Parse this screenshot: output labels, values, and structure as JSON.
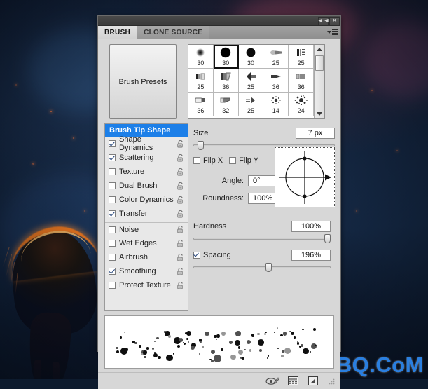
{
  "background": {
    "watermark": "UiBQ.CoM"
  },
  "panel": {
    "titlebar": {
      "collapse_label": "◄◄",
      "close_label": "✕"
    },
    "tabs": [
      {
        "label": "BRUSH",
        "active": true
      },
      {
        "label": "CLONE SOURCE",
        "active": false
      }
    ],
    "menu_icon": "panel-menu-icon",
    "brush_presets_button": "Brush Presets",
    "brush_grid": {
      "cells": [
        {
          "size": "30",
          "shape": "soft-round",
          "selected": false
        },
        {
          "size": "30",
          "shape": "hard-round",
          "selected": true
        },
        {
          "size": "30",
          "shape": "hard-round-2",
          "selected": false
        },
        {
          "size": "25",
          "shape": "flat-tip",
          "selected": false
        },
        {
          "size": "25",
          "shape": "bristle-block",
          "selected": false
        },
        {
          "size": "25",
          "shape": "flat-block",
          "selected": false
        },
        {
          "size": "36",
          "shape": "angled-block",
          "selected": false
        },
        {
          "size": "25",
          "shape": "fan-tip",
          "selected": false
        },
        {
          "size": "36",
          "shape": "round-point",
          "selected": false
        },
        {
          "size": "36",
          "shape": "square-tip",
          "selected": false
        },
        {
          "size": "36",
          "shape": "rounded-tip",
          "selected": false
        },
        {
          "size": "32",
          "shape": "chisel-tip",
          "selected": false
        },
        {
          "size": "25",
          "shape": "fan-soft",
          "selected": false
        },
        {
          "size": "14",
          "shape": "spatter",
          "selected": false
        },
        {
          "size": "24",
          "shape": "scatter-spray",
          "selected": false
        }
      ],
      "scrollbar": {
        "up": "scroll-up-arrow",
        "down": "scroll-down-arrow"
      }
    },
    "options_list": {
      "header": "Brush Tip Shape",
      "items": [
        {
          "label": "Shape Dynamics",
          "checked": true,
          "group": 1
        },
        {
          "label": "Scattering",
          "checked": true,
          "group": 1
        },
        {
          "label": "Texture",
          "checked": false,
          "group": 1
        },
        {
          "label": "Dual Brush",
          "checked": false,
          "group": 1
        },
        {
          "label": "Color Dynamics",
          "checked": false,
          "group": 1
        },
        {
          "label": "Transfer",
          "checked": true,
          "group": 1
        },
        {
          "label": "Noise",
          "checked": false,
          "group": 2
        },
        {
          "label": "Wet Edges",
          "checked": false,
          "group": 2
        },
        {
          "label": "Airbrush",
          "checked": false,
          "group": 2
        },
        {
          "label": "Smoothing",
          "checked": true,
          "group": 2
        },
        {
          "label": "Protect Texture",
          "checked": false,
          "group": 2
        }
      ]
    },
    "settings": {
      "size_label": "Size",
      "size_value": "7 px",
      "size_slider_percent": 3,
      "flip_x_label": "Flip X",
      "flip_x_checked": false,
      "flip_y_label": "Flip Y",
      "flip_y_checked": false,
      "angle_label": "Angle:",
      "angle_value": "0°",
      "roundness_label": "Roundness:",
      "roundness_value": "100%",
      "hardness_label": "Hardness",
      "hardness_value": "100%",
      "hardness_slider_percent": 100,
      "spacing_label": "Spacing",
      "spacing_checked": true,
      "spacing_value": "196%",
      "spacing_slider_percent": 55,
      "preview_thumb": "brush-angle-preview"
    },
    "footer": {
      "icons": [
        {
          "name": "toggle-brush-preview-icon"
        },
        {
          "name": "create-new-preset-icon"
        },
        {
          "name": "new-brush-icon"
        }
      ],
      "resize_grip": "resize-grip-icon"
    }
  }
}
